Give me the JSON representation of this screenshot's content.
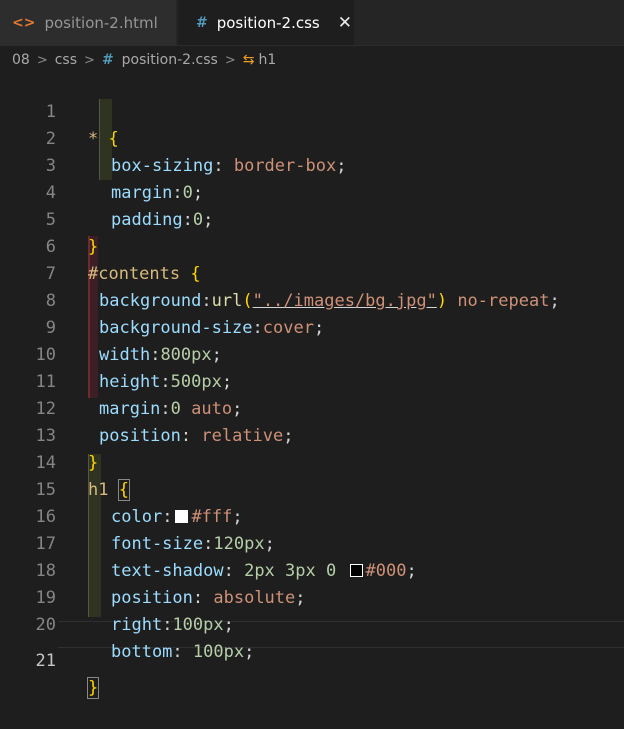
{
  "tabs": [
    {
      "label": "position-2.html",
      "icon": "html-code-icon",
      "active": false
    },
    {
      "label": "position-2.css",
      "icon": "css-hash-icon",
      "active": true,
      "close": "✕"
    }
  ],
  "breadcrumb": {
    "root": "08",
    "folder": "css",
    "file": "position-2.css",
    "symbol": "h1"
  },
  "editor": {
    "active_line": 21,
    "lines": [
      {
        "n": "1"
      },
      {
        "n": "2"
      },
      {
        "n": "3"
      },
      {
        "n": "4"
      },
      {
        "n": "5"
      },
      {
        "n": "6"
      },
      {
        "n": "7"
      },
      {
        "n": "8"
      },
      {
        "n": "9"
      },
      {
        "n": "10"
      },
      {
        "n": "11"
      },
      {
        "n": "12"
      },
      {
        "n": "13"
      },
      {
        "n": "14"
      },
      {
        "n": "15"
      },
      {
        "n": "16"
      },
      {
        "n": "17"
      },
      {
        "n": "18"
      },
      {
        "n": "19"
      },
      {
        "n": "20"
      },
      {
        "n": "21"
      }
    ],
    "tokens": {
      "l1_sel": "*",
      "l1_brace": "{",
      "l2_prop": "box-sizing",
      "l2_val": "border-box",
      "l3_prop": "margin",
      "l3_val": "0",
      "l4_prop": "padding",
      "l4_val": "0",
      "l5_brace": "}",
      "l6_sel": "#contents",
      "l6_brace": "{",
      "l7_prop": "background",
      "l7_fn": "url",
      "l7_str": "\"../images/bg.jpg\"",
      "l7_val": "no-repeat",
      "l8_prop": "background-size",
      "l8_val": "cover",
      "l9_prop": "width",
      "l9_val": "800px",
      "l10_prop": "height",
      "l10_val": "500px",
      "l11_prop": "margin",
      "l11_num": "0",
      "l11_val": "auto",
      "l12_prop": "position",
      "l12_val": "relative",
      "l13_brace": "}",
      "l14_sel": "h1",
      "l14_brace": "{",
      "l15_prop": "color",
      "l15_val": "#fff",
      "l16_prop": "font-size",
      "l16_val": "120px",
      "l17_prop": "text-shadow",
      "l17_num1": "2px",
      "l17_num2": "3px",
      "l17_num3": "0",
      "l17_val": "#000",
      "l18_prop": "position",
      "l18_val": "absolute",
      "l19_prop": "right",
      "l19_val": "100px",
      "l20_prop": "bottom",
      "l20_val": "100px",
      "l21_brace": "}"
    }
  },
  "colors": {
    "swatch_white": "#ffffff",
    "swatch_black": "#000000"
  }
}
